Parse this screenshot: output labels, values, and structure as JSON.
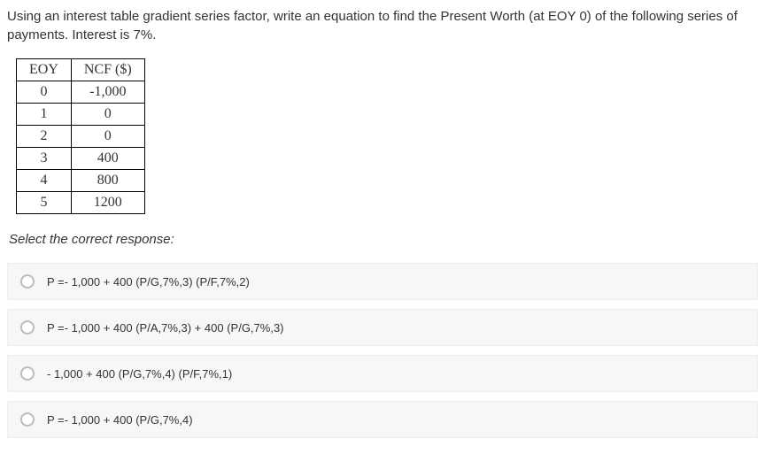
{
  "question": {
    "text": "Using an interest table gradient series factor, write an equation to find the Present Worth (at EOY 0) of the following series of payments. Interest is 7%."
  },
  "table": {
    "headers": [
      "EOY",
      "NCF ($)"
    ],
    "rows": [
      [
        "0",
        "-1,000"
      ],
      [
        "1",
        "0"
      ],
      [
        "2",
        "0"
      ],
      [
        "3",
        "400"
      ],
      [
        "4",
        "800"
      ],
      [
        "5",
        "1200"
      ]
    ]
  },
  "prompt": "Select the correct response:",
  "options": [
    "P =- 1,000 + 400 (P/G,7%,3) (P/F,7%,2)",
    "P =- 1,000 + 400 (P/A,7%,3) + 400 (P/G,7%,3)",
    "- 1,000 + 400 (P/G,7%,4) (P/F,7%,1)",
    "P =- 1,000 + 400 (P/G,7%,4)"
  ]
}
